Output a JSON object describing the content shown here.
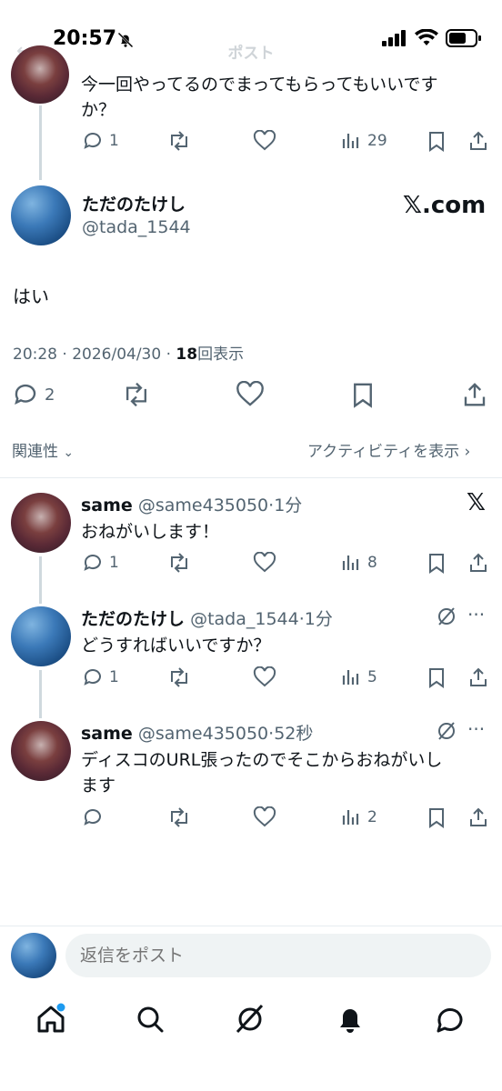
{
  "status": {
    "time": "20:57"
  },
  "header": {
    "title": "ポスト"
  },
  "parent_reply": {
    "text_line1": "今一回やってるのでまってもらってもいいです",
    "text_line2": "か？",
    "replies": "1",
    "views": "29"
  },
  "main_post": {
    "display_name": "ただのたけし",
    "handle": "@tada_1544",
    "watermark": "𝕏.com",
    "body": "はい",
    "timestamp": "20:28 · 2026/04/30 · ",
    "views_count": "18",
    "views_label": "回表示",
    "replies": "2"
  },
  "sort": {
    "label": "関連性",
    "activity_label": "アクティビティを表示"
  },
  "replies": [
    {
      "name": "same",
      "handle": "@same435050",
      "time": "1分",
      "text_line1": "おねがいします！",
      "text_line2": "",
      "replies": "1",
      "views": "8"
    },
    {
      "name": "ただのたけし",
      "handle": "@tada_1544",
      "time": "1分",
      "text_line1": "どうすればいいですか？",
      "text_line2": "",
      "replies": "1",
      "views": "5"
    },
    {
      "name": "same",
      "handle": "@same435050",
      "time": "52秒",
      "text_line1": "ディスコのURL張ったのでそこからおねがいし",
      "text_line2": "ます",
      "replies": "",
      "views": "2"
    }
  ],
  "reply_box": {
    "placeholder": "返信をポスト"
  },
  "tabs": [
    "home-icon",
    "search-icon",
    "grok-icon",
    "notifications-icon",
    "messages-icon"
  ],
  "colors": {
    "accent": "#1d9bf0",
    "muted": "#536471",
    "line": "#cfd9de"
  }
}
